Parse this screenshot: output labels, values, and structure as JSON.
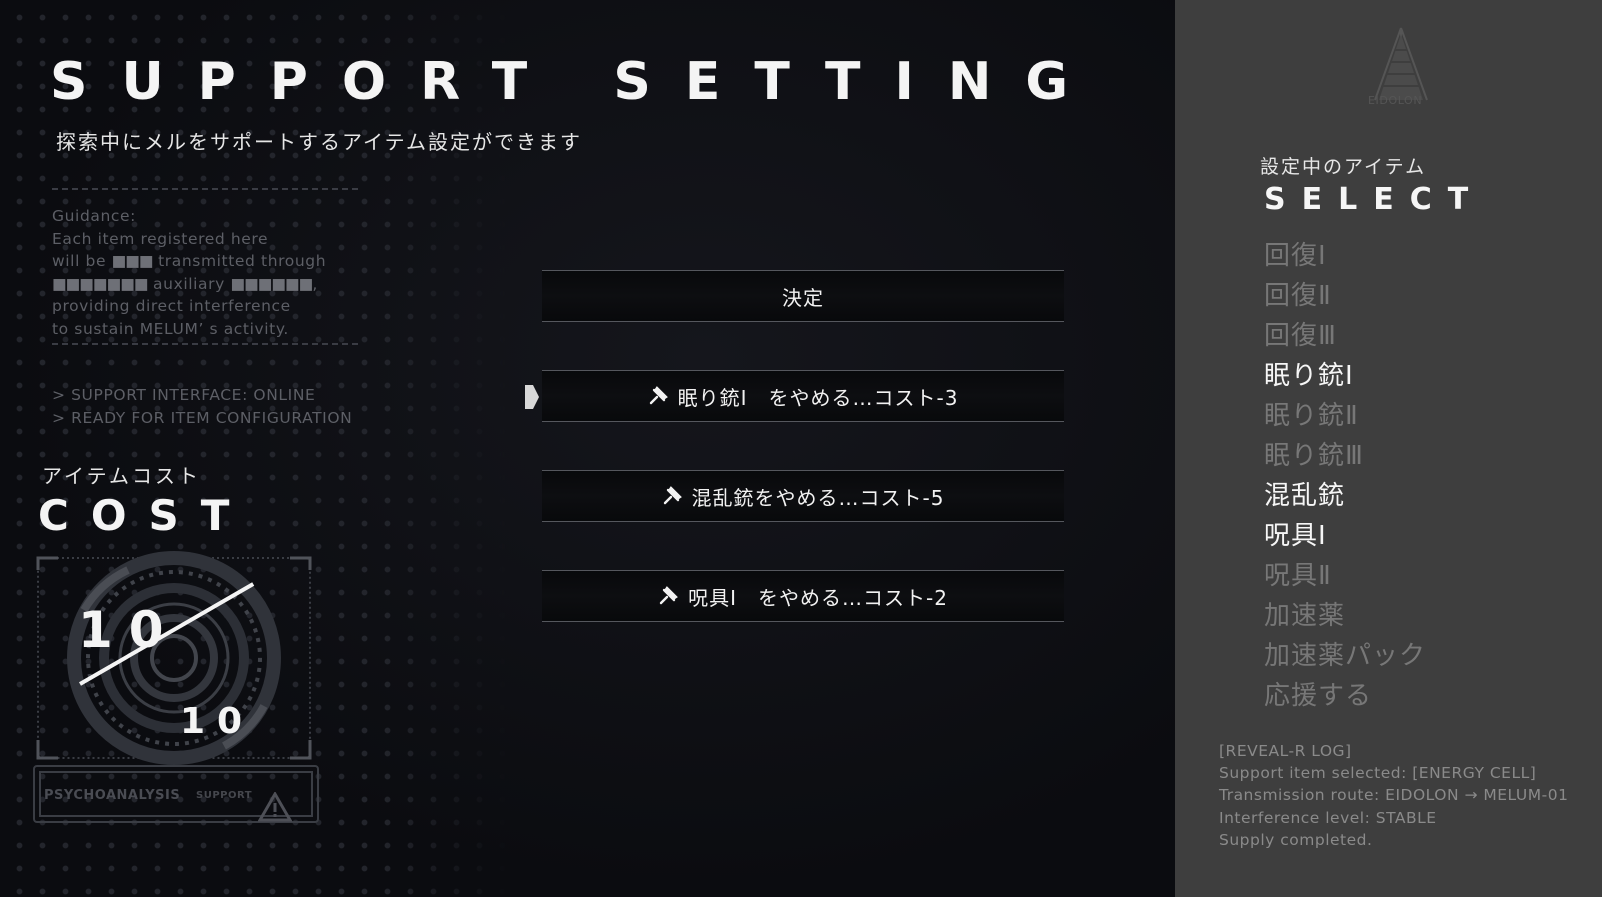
{
  "header": {
    "title": "SUPPORT SETTING",
    "subtitle": "探索中にメルをサポートするアイテム設定ができます"
  },
  "guidance": {
    "lines": [
      {
        "text": "Guidance:"
      },
      {
        "text": "Each item registered here"
      },
      {
        "pre": "will be ",
        "blocks": "■■■",
        "post": " transmitted through"
      },
      {
        "pre": "",
        "blocks": "■■■■■■■",
        "post": " auxiliary ",
        "blocks2": "■■■■■■",
        "post2": ","
      },
      {
        "text": "providing direct interference"
      },
      {
        "text": "to sustain MELUM’ s activity."
      }
    ]
  },
  "system_log": {
    "lines": [
      "> SUPPORT INTERFACE: ONLINE",
      "> READY FOR ITEM CONFIGURATION"
    ]
  },
  "cost": {
    "label_jp": "アイテムコスト",
    "label_en": "COST",
    "current": "10",
    "max": "10",
    "fraction": 1.0,
    "psycho_label": "PSYCHOANALYSIS",
    "support_label": "SUPPORT"
  },
  "options": {
    "confirm": "決定",
    "items": [
      {
        "label": "眠り銃I　をやめる…コスト-3",
        "icon": "pin-icon"
      },
      {
        "label": "混乱銃をやめる…コスト-5",
        "icon": "pin-icon"
      },
      {
        "label": "呪具I　をやめる…コスト-2",
        "icon": "pin-icon"
      }
    ]
  },
  "panel": {
    "logo_text": "EIDOLON",
    "select_label_jp": "設定中のアイテム",
    "select_label_en": "SELECT",
    "items": [
      {
        "label": "回復Ⅰ",
        "active": false
      },
      {
        "label": "回復Ⅱ",
        "active": false
      },
      {
        "label": "回復Ⅲ",
        "active": false
      },
      {
        "label": "眠り銃Ⅰ",
        "active": true
      },
      {
        "label": "眠り銃Ⅱ",
        "active": false
      },
      {
        "label": "眠り銃Ⅲ",
        "active": false
      },
      {
        "label": "混乱銃",
        "active": true
      },
      {
        "label": "呪具Ⅰ",
        "active": true
      },
      {
        "label": "呪具Ⅱ",
        "active": false
      },
      {
        "label": "加速薬",
        "active": false
      },
      {
        "label": "加速薬パック",
        "active": false
      },
      {
        "label": "応援する",
        "active": false
      }
    ],
    "reveal_log": [
      "[REVEAL-R LOG]",
      "Support item selected: [ENERGY CELL]",
      "Transmission route: EIDOLON → MELUM-01",
      "Interference level: STABLE",
      "Supply completed."
    ]
  },
  "colors": {
    "background": "#0b0c10",
    "panel": "#3e3e3e",
    "text_primary": "#f4f4f4",
    "text_dim": "#5d5f66",
    "item_inactive": "#777777"
  }
}
